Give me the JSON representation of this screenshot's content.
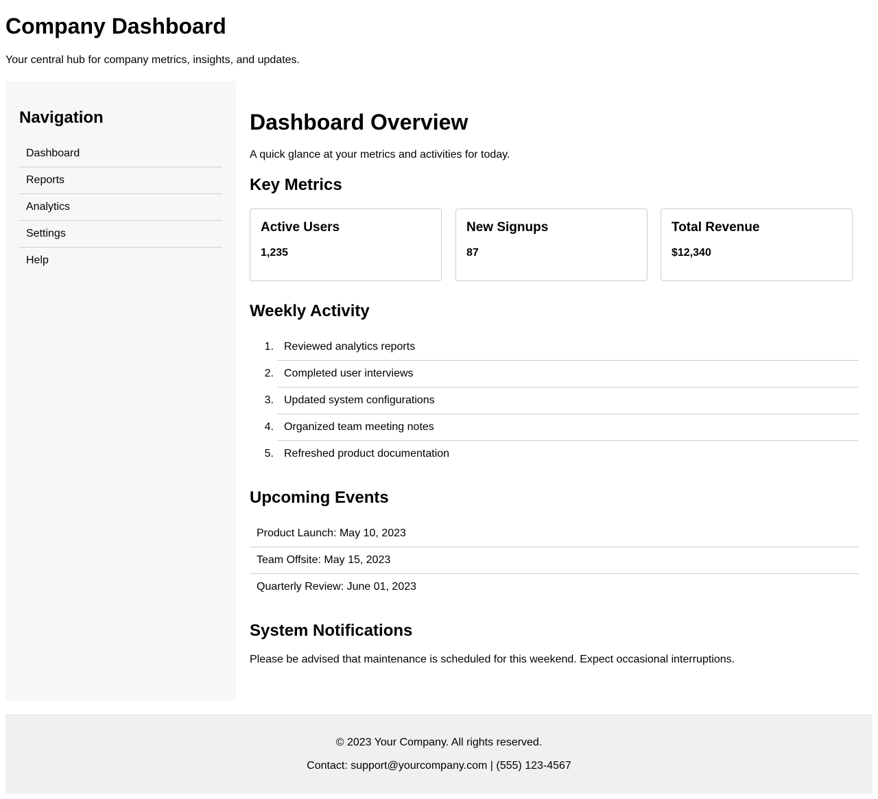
{
  "header": {
    "title": "Company Dashboard",
    "subtitle": "Your central hub for company metrics, insights, and updates."
  },
  "sidebar": {
    "heading": "Navigation",
    "items": [
      {
        "label": "Dashboard"
      },
      {
        "label": "Reports"
      },
      {
        "label": "Analytics"
      },
      {
        "label": "Settings"
      },
      {
        "label": "Help"
      }
    ]
  },
  "main": {
    "title": "Dashboard Overview",
    "description": "A quick glance at your metrics and activities for today.",
    "metrics": {
      "heading": "Key Metrics",
      "cards": [
        {
          "label": "Active Users",
          "value": "1,235"
        },
        {
          "label": "New Signups",
          "value": "87"
        },
        {
          "label": "Total Revenue",
          "value": "$12,340"
        }
      ]
    },
    "activity": {
      "heading": "Weekly Activity",
      "items": [
        {
          "num": "1.",
          "text": "Reviewed analytics reports"
        },
        {
          "num": "2.",
          "text": "Completed user interviews"
        },
        {
          "num": "3.",
          "text": "Updated system configurations"
        },
        {
          "num": "4.",
          "text": "Organized team meeting notes"
        },
        {
          "num": "5.",
          "text": "Refreshed product documentation"
        }
      ]
    },
    "events": {
      "heading": "Upcoming Events",
      "items": [
        {
          "text": "Product Launch: May 10, 2023"
        },
        {
          "text": "Team Offsite: May 15, 2023"
        },
        {
          "text": "Quarterly Review: June 01, 2023"
        }
      ]
    },
    "notifications": {
      "heading": "System Notifications",
      "text": "Please be advised that maintenance is scheduled for this weekend. Expect occasional interruptions."
    }
  },
  "footer": {
    "copyright": "© 2023 Your Company. All rights reserved.",
    "contact": "Contact: support@yourcompany.com | (555) 123-4567"
  }
}
